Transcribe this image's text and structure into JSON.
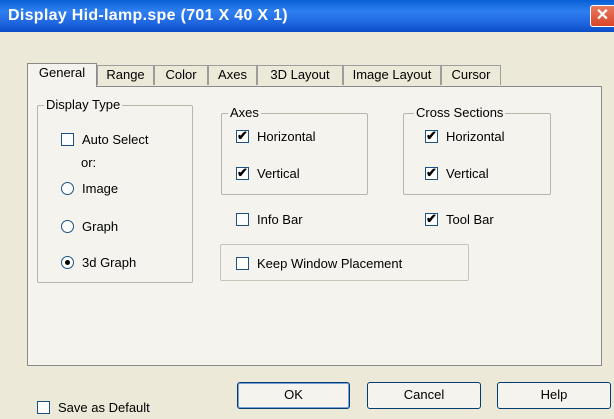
{
  "window": {
    "title": "Display Hid-lamp.spe (701 X 40 X 1)",
    "close_glyph": "✕"
  },
  "tabs": [
    {
      "label": "General",
      "active": true
    },
    {
      "label": "Range"
    },
    {
      "label": "Color"
    },
    {
      "label": "Axes"
    },
    {
      "label": "3D Layout"
    },
    {
      "label": "Image Layout"
    },
    {
      "label": "Cursor"
    }
  ],
  "display_type": {
    "legend": "Display Type",
    "auto_select": {
      "label": "Auto Select",
      "checked": false
    },
    "or_label": "or:",
    "options": [
      {
        "label": "Image",
        "selected": false
      },
      {
        "label": "Graph",
        "selected": false
      },
      {
        "label": "3d Graph",
        "selected": true
      }
    ]
  },
  "axes": {
    "legend": "Axes",
    "horizontal": {
      "label": "Horizontal",
      "checked": true
    },
    "vertical": {
      "label": "Vertical",
      "checked": true
    }
  },
  "cross_sections": {
    "legend": "Cross Sections",
    "horizontal": {
      "label": "Horizontal",
      "checked": true
    },
    "vertical": {
      "label": "Vertical",
      "checked": true
    }
  },
  "info_bar": {
    "label": "Info Bar",
    "checked": false
  },
  "tool_bar": {
    "label": "Tool Bar",
    "checked": true
  },
  "keep_window_placement": {
    "label": "Keep Window Placement",
    "checked": false
  },
  "save_as_default": {
    "label": "Save as Default",
    "checked": false
  },
  "buttons": {
    "ok": "OK",
    "cancel": "Cancel",
    "help": "Help"
  },
  "check_glyph": "✔"
}
